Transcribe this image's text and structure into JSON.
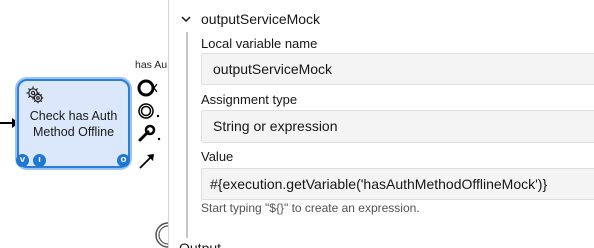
{
  "canvas": {
    "task": {
      "label_line1": "Check has Auth",
      "label_line2": "Method Offline",
      "icon": "service-task-gear-icon",
      "markers": [
        "V",
        "I",
        "O"
      ],
      "fill_color": "#dbe8fb",
      "border_color": "#2a7fd8"
    },
    "context_label": "has Au",
    "context_pad_icons": [
      "end-event-icon",
      "intermediate-event-icon",
      "wrench-icon",
      "connect-arrow-icon"
    ]
  },
  "panel": {
    "group": {
      "title": "outputServiceMock",
      "expanded": true
    },
    "fields": {
      "local_variable_name": {
        "label": "Local variable name",
        "value": "outputServiceMock"
      },
      "assignment_type": {
        "label": "Assignment type",
        "value": "String or expression"
      },
      "value": {
        "label": "Value",
        "value": "#{execution.getVariable('hasAuthMethodOfflineMock')}",
        "hint": "Start typing \"${}\" to create an expression."
      }
    },
    "next_group_title": "Output"
  }
}
